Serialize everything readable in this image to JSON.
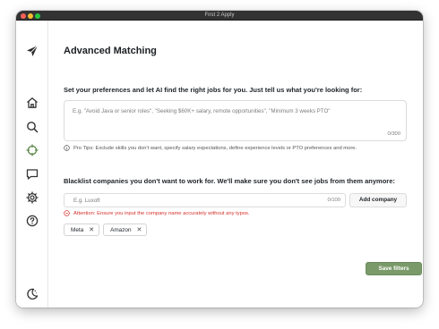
{
  "window": {
    "title": "First 2 Apply"
  },
  "colors": {
    "accent": "#7a9a69",
    "warning": "#d4302b",
    "active_nav": "#5f8a4c"
  },
  "sidebar": {
    "items": [
      {
        "name": "logo",
        "icon": "paper-plane-icon"
      },
      {
        "name": "home",
        "icon": "home-icon"
      },
      {
        "name": "search",
        "icon": "search-icon"
      },
      {
        "name": "advanced-matching",
        "icon": "crosshair-icon",
        "active": true
      },
      {
        "name": "feedback",
        "icon": "chat-icon"
      },
      {
        "name": "settings",
        "icon": "gear-icon"
      },
      {
        "name": "help",
        "icon": "help-icon"
      },
      {
        "name": "theme",
        "icon": "moon-icon"
      }
    ]
  },
  "page": {
    "title": "Advanced Matching",
    "preferences": {
      "heading": "Set your preferences and let AI find the right jobs for you. Just tell us what you're looking for:",
      "placeholder": "E.g. \"Avoid Java or senior roles\", \"Seeking $60K+ salary, remote opportunities\", \"Minimum 3 weeks PTO\"",
      "value": "",
      "counter": "0/300",
      "tip": "Pro Tips: Exclude skills you don't want, specify salary expectations, define experience levels or PTO preferences and more."
    },
    "blacklist": {
      "heading": "Blacklist companies you don't want to work for. We'll make sure you don't see jobs from them anymore:",
      "placeholder": "E.g. Luxoft",
      "value": "",
      "counter": "0/100",
      "add_label": "Add company",
      "warning": "Attention: Ensure you input the company name accurately without any typos.",
      "companies": [
        "Meta",
        "Amazon"
      ],
      "remove_glyph": "✕"
    },
    "save_label": "Save filters"
  }
}
